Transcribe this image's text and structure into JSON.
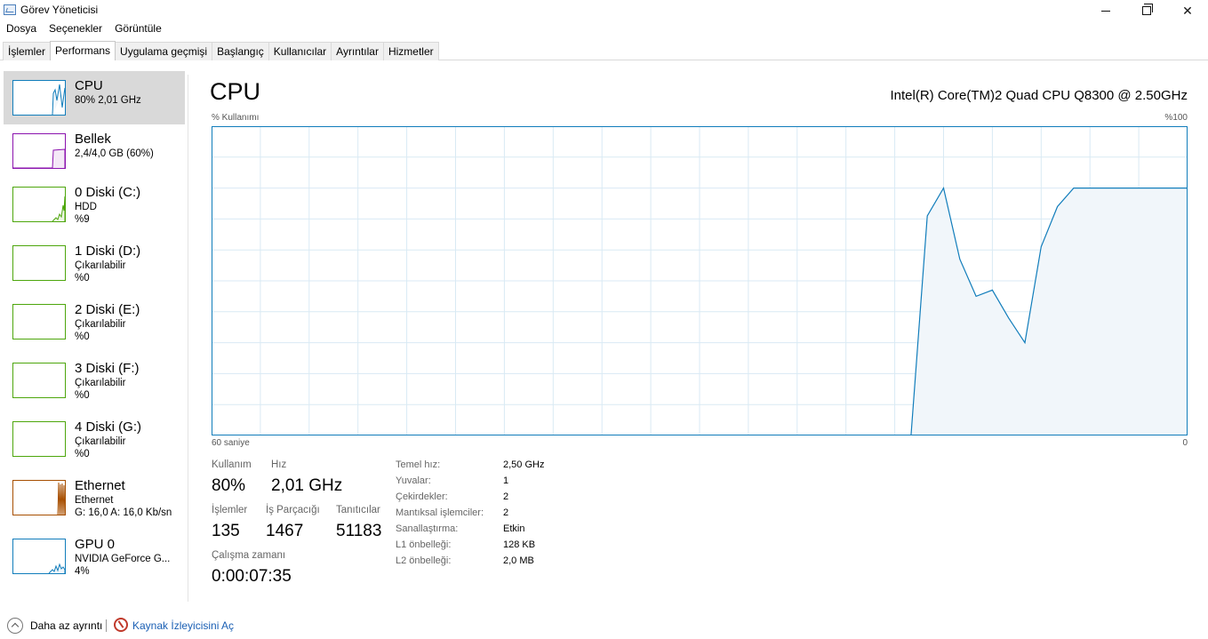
{
  "window": {
    "title": "Görev Yöneticisi",
    "minimize_icon": "minimize-icon",
    "maximize_icon": "restore-icon",
    "close_label": "✕"
  },
  "menu": [
    "Dosya",
    "Seçenekler",
    "Görüntüle"
  ],
  "tabs": [
    {
      "label": "İşlemler",
      "active": false
    },
    {
      "label": "Performans",
      "active": true
    },
    {
      "label": "Uygulama geçmişi",
      "active": false
    },
    {
      "label": "Başlangıç",
      "active": false
    },
    {
      "label": "Kullanıcılar",
      "active": false
    },
    {
      "label": "Ayrıntılar",
      "active": false
    },
    {
      "label": "Hizmetler",
      "active": false
    }
  ],
  "sidebar": {
    "items": [
      {
        "name": "CPU",
        "sub1": "80%  2,01 GHz",
        "sub2": "",
        "color": "#117dbb",
        "selected": true
      },
      {
        "name": "Bellek",
        "sub1": "2,4/4,0 GB (60%)",
        "sub2": "",
        "color": "#8b12ae",
        "selected": false
      },
      {
        "name": "0 Diski (C:)",
        "sub1": "HDD",
        "sub2": "%9",
        "color": "#4da60c",
        "selected": false
      },
      {
        "name": "1 Diski (D:)",
        "sub1": "Çıkarılabilir",
        "sub2": "%0",
        "color": "#4da60c",
        "selected": false
      },
      {
        "name": "2 Diski (E:)",
        "sub1": "Çıkarılabilir",
        "sub2": "%0",
        "color": "#4da60c",
        "selected": false
      },
      {
        "name": "3 Diski (F:)",
        "sub1": "Çıkarılabilir",
        "sub2": "%0",
        "color": "#4da60c",
        "selected": false
      },
      {
        "name": "4 Diski (G:)",
        "sub1": "Çıkarılabilir",
        "sub2": "%0",
        "color": "#4da60c",
        "selected": false
      },
      {
        "name": "Ethernet",
        "sub1": "Ethernet",
        "sub2": "G: 16,0  A: 16,0 Kb/sn",
        "color": "#a74f01",
        "selected": false
      },
      {
        "name": "GPU 0",
        "sub1": "NVIDIA GeForce G...",
        "sub2": "4%",
        "color": "#117dbb",
        "selected": false
      }
    ]
  },
  "main": {
    "title": "CPU",
    "cpu_model": "Intel(R) Core(TM)2 Quad CPU Q8300 @ 2.50GHz",
    "axis_top_left": "% Kullanımı",
    "axis_top_right": "%100",
    "axis_bottom_left": "60 saniye",
    "axis_bottom_right": "0",
    "accent_color": "#117dbb",
    "fill_color": "#f1f6fa"
  },
  "chart_data": {
    "type": "area",
    "title": "CPU",
    "ylabel": "% Kullanımı",
    "xlabel": "60 saniye",
    "ylim": [
      0,
      100
    ],
    "xlim": [
      60,
      0
    ],
    "grid": true,
    "x": [
      60,
      17,
      16,
      15,
      14,
      13,
      12,
      11,
      10,
      9,
      8,
      7,
      6,
      5,
      4,
      3,
      2,
      1,
      0
    ],
    "values": [
      0,
      0,
      71,
      80,
      57,
      45,
      47,
      38,
      30,
      61,
      74,
      80,
      80,
      80,
      80,
      80,
      80,
      80,
      80
    ]
  },
  "stats": {
    "usage_label": "Kullanım",
    "usage_value": "80%",
    "speed_label": "Hız",
    "speed_value": "2,01 GHz",
    "processes_label": "İşlemler",
    "processes_value": "135",
    "threads_label": "İş Parçacığı",
    "threads_value": "1467",
    "handles_label": "Tanıtıcılar",
    "handles_value": "51183",
    "uptime_label": "Çalışma zamanı",
    "uptime_value": "0:00:07:35"
  },
  "info": [
    {
      "label": "Temel hız:",
      "value": "2,50 GHz"
    },
    {
      "label": "Yuvalar:",
      "value": "1"
    },
    {
      "label": "Çekirdekler:",
      "value": "2"
    },
    {
      "label": "Mantıksal işlemciler:",
      "value": "2"
    },
    {
      "label": "Sanallaştırma:",
      "value": "Etkin"
    },
    {
      "label": "L1 önbelleği:",
      "value": "128 KB"
    },
    {
      "label": "L2 önbelleği:",
      "value": "2,0 MB"
    }
  ],
  "footer": {
    "less_detail": "Daha az ayrıntı",
    "resource_monitor": "Kaynak İzleyicisini Aç"
  }
}
